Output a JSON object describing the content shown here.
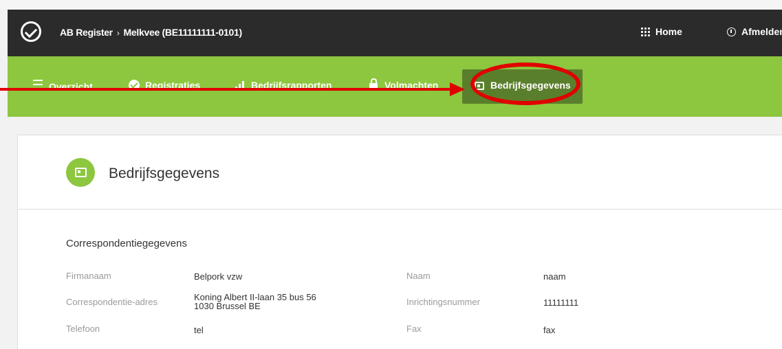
{
  "topbar": {
    "breadcrumb_root": "AB Register",
    "breadcrumb_separator": "›",
    "breadcrumb_current": "Melkvee (BE11111111-0101)",
    "home_label": "Home",
    "logout_label": "Afmelden"
  },
  "nav": {
    "items": [
      {
        "label": "Overzicht",
        "icon": "list-icon"
      },
      {
        "label": "Registraties",
        "icon": "check-circle-icon"
      },
      {
        "label": "Bedrijfsrapporten",
        "icon": "bar-chart-icon"
      },
      {
        "label": "Volmachten",
        "icon": "lock-icon"
      },
      {
        "label": "Bedrijfsgegevens",
        "icon": "id-card-icon",
        "active": true
      }
    ]
  },
  "page": {
    "title": "Bedrijfsgegevens",
    "section_title": "Correspondentiegegevens",
    "fields": {
      "firmanaam_label": "Firmanaam",
      "firmanaam_value": "Belpork vzw",
      "adres_label": "Correspondentie-adres",
      "adres_line1": "Koning Albert II-laan 35 bus 56",
      "adres_line2": "1030 Brussel BE",
      "telefoon_label": "Telefoon",
      "telefoon_value": "tel",
      "naam_label": "Naam",
      "naam_value": "naam",
      "inrichting_label": "Inrichtingsnummer",
      "inrichting_value": "11111111",
      "fax_label": "Fax",
      "fax_value": "fax"
    }
  },
  "colors": {
    "topbar": "#2b2b2b",
    "nav_green": "#8dc63f",
    "nav_active": "#5a7f2c",
    "annotation_red": "#e00000"
  }
}
